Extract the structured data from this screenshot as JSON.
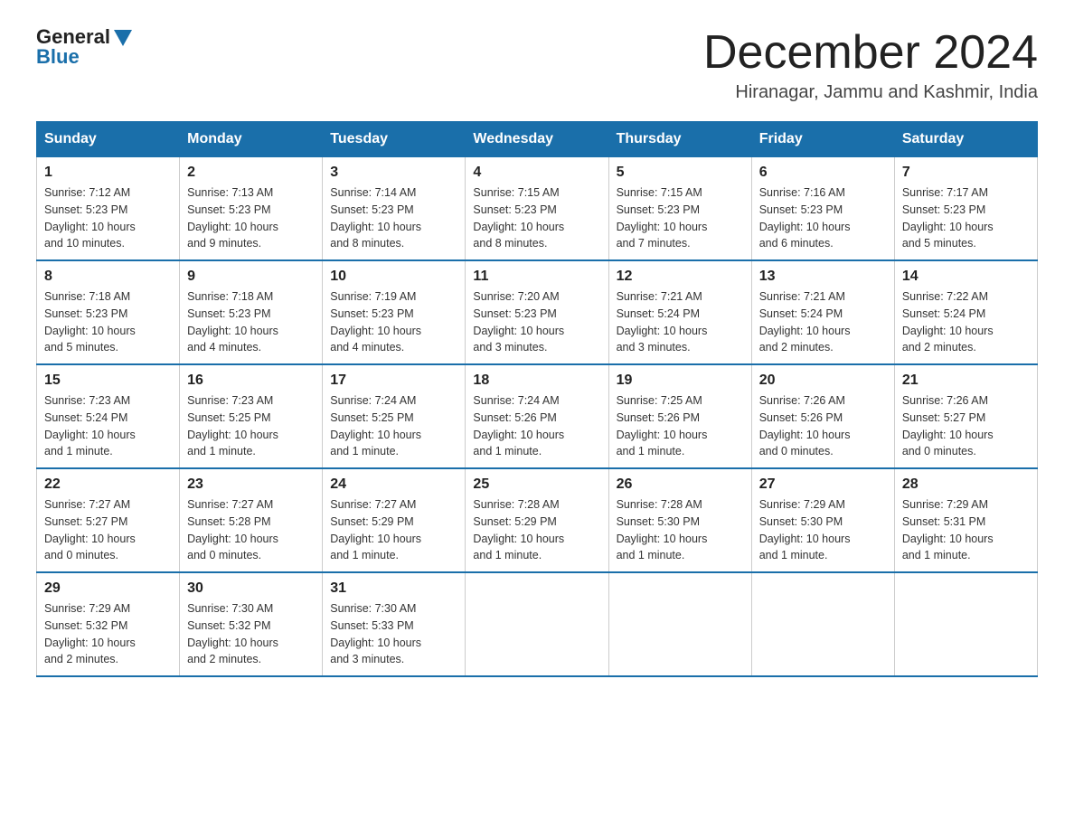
{
  "logo": {
    "general": "General",
    "blue": "Blue"
  },
  "title": "December 2024",
  "location": "Hiranagar, Jammu and Kashmir, India",
  "days_of_week": [
    "Sunday",
    "Monday",
    "Tuesday",
    "Wednesday",
    "Thursday",
    "Friday",
    "Saturday"
  ],
  "weeks": [
    [
      {
        "day": "1",
        "sunrise": "7:12 AM",
        "sunset": "5:23 PM",
        "daylight": "10 hours and 10 minutes."
      },
      {
        "day": "2",
        "sunrise": "7:13 AM",
        "sunset": "5:23 PM",
        "daylight": "10 hours and 9 minutes."
      },
      {
        "day": "3",
        "sunrise": "7:14 AM",
        "sunset": "5:23 PM",
        "daylight": "10 hours and 8 minutes."
      },
      {
        "day": "4",
        "sunrise": "7:15 AM",
        "sunset": "5:23 PM",
        "daylight": "10 hours and 8 minutes."
      },
      {
        "day": "5",
        "sunrise": "7:15 AM",
        "sunset": "5:23 PM",
        "daylight": "10 hours and 7 minutes."
      },
      {
        "day": "6",
        "sunrise": "7:16 AM",
        "sunset": "5:23 PM",
        "daylight": "10 hours and 6 minutes."
      },
      {
        "day": "7",
        "sunrise": "7:17 AM",
        "sunset": "5:23 PM",
        "daylight": "10 hours and 5 minutes."
      }
    ],
    [
      {
        "day": "8",
        "sunrise": "7:18 AM",
        "sunset": "5:23 PM",
        "daylight": "10 hours and 5 minutes."
      },
      {
        "day": "9",
        "sunrise": "7:18 AM",
        "sunset": "5:23 PM",
        "daylight": "10 hours and 4 minutes."
      },
      {
        "day": "10",
        "sunrise": "7:19 AM",
        "sunset": "5:23 PM",
        "daylight": "10 hours and 4 minutes."
      },
      {
        "day": "11",
        "sunrise": "7:20 AM",
        "sunset": "5:23 PM",
        "daylight": "10 hours and 3 minutes."
      },
      {
        "day": "12",
        "sunrise": "7:21 AM",
        "sunset": "5:24 PM",
        "daylight": "10 hours and 3 minutes."
      },
      {
        "day": "13",
        "sunrise": "7:21 AM",
        "sunset": "5:24 PM",
        "daylight": "10 hours and 2 minutes."
      },
      {
        "day": "14",
        "sunrise": "7:22 AM",
        "sunset": "5:24 PM",
        "daylight": "10 hours and 2 minutes."
      }
    ],
    [
      {
        "day": "15",
        "sunrise": "7:23 AM",
        "sunset": "5:24 PM",
        "daylight": "10 hours and 1 minute."
      },
      {
        "day": "16",
        "sunrise": "7:23 AM",
        "sunset": "5:25 PM",
        "daylight": "10 hours and 1 minute."
      },
      {
        "day": "17",
        "sunrise": "7:24 AM",
        "sunset": "5:25 PM",
        "daylight": "10 hours and 1 minute."
      },
      {
        "day": "18",
        "sunrise": "7:24 AM",
        "sunset": "5:26 PM",
        "daylight": "10 hours and 1 minute."
      },
      {
        "day": "19",
        "sunrise": "7:25 AM",
        "sunset": "5:26 PM",
        "daylight": "10 hours and 1 minute."
      },
      {
        "day": "20",
        "sunrise": "7:26 AM",
        "sunset": "5:26 PM",
        "daylight": "10 hours and 0 minutes."
      },
      {
        "day": "21",
        "sunrise": "7:26 AM",
        "sunset": "5:27 PM",
        "daylight": "10 hours and 0 minutes."
      }
    ],
    [
      {
        "day": "22",
        "sunrise": "7:27 AM",
        "sunset": "5:27 PM",
        "daylight": "10 hours and 0 minutes."
      },
      {
        "day": "23",
        "sunrise": "7:27 AM",
        "sunset": "5:28 PM",
        "daylight": "10 hours and 0 minutes."
      },
      {
        "day": "24",
        "sunrise": "7:27 AM",
        "sunset": "5:29 PM",
        "daylight": "10 hours and 1 minute."
      },
      {
        "day": "25",
        "sunrise": "7:28 AM",
        "sunset": "5:29 PM",
        "daylight": "10 hours and 1 minute."
      },
      {
        "day": "26",
        "sunrise": "7:28 AM",
        "sunset": "5:30 PM",
        "daylight": "10 hours and 1 minute."
      },
      {
        "day": "27",
        "sunrise": "7:29 AM",
        "sunset": "5:30 PM",
        "daylight": "10 hours and 1 minute."
      },
      {
        "day": "28",
        "sunrise": "7:29 AM",
        "sunset": "5:31 PM",
        "daylight": "10 hours and 1 minute."
      }
    ],
    [
      {
        "day": "29",
        "sunrise": "7:29 AM",
        "sunset": "5:32 PM",
        "daylight": "10 hours and 2 minutes."
      },
      {
        "day": "30",
        "sunrise": "7:30 AM",
        "sunset": "5:32 PM",
        "daylight": "10 hours and 2 minutes."
      },
      {
        "day": "31",
        "sunrise": "7:30 AM",
        "sunset": "5:33 PM",
        "daylight": "10 hours and 3 minutes."
      },
      null,
      null,
      null,
      null
    ]
  ],
  "labels": {
    "sunrise": "Sunrise:",
    "sunset": "Sunset:",
    "daylight": "Daylight:"
  }
}
